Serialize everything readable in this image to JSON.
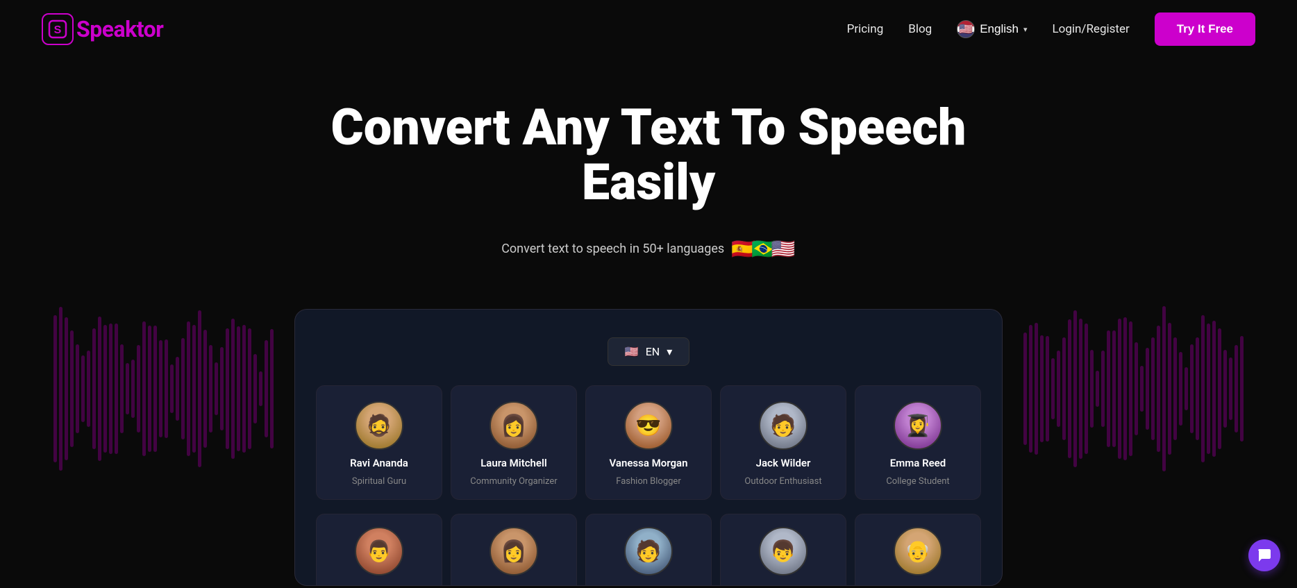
{
  "logo": {
    "icon_letter": "S",
    "text_before": "",
    "text_brand": "Speaktor"
  },
  "nav": {
    "pricing_label": "Pricing",
    "blog_label": "Blog",
    "language_label": "English",
    "login_label": "Login/Register",
    "cta_label": "Try It Free"
  },
  "hero": {
    "headline": "Convert Any Text To Speech Easily",
    "subtext": "Convert text to speech in 50+ languages",
    "flags": [
      "🇪🇸",
      "🇧🇷",
      "🇺🇸"
    ]
  },
  "demo": {
    "lang_selector": {
      "flag": "🇺🇸",
      "code": "EN",
      "chevron": "▾"
    },
    "voice_cards": [
      {
        "id": "ravi",
        "name": "Ravi Ananda",
        "role": "Spiritual Guru",
        "avatar_class": "av-ravi",
        "emoji": "🧔"
      },
      {
        "id": "laura",
        "name": "Laura Mitchell",
        "role": "Community Organizer",
        "avatar_class": "av-laura",
        "emoji": "👩"
      },
      {
        "id": "vanessa",
        "name": "Vanessa Morgan",
        "role": "Fashion Blogger",
        "avatar_class": "av-vanessa",
        "emoji": "😎"
      },
      {
        "id": "jack",
        "name": "Jack Wilder",
        "role": "Outdoor Enthusiast",
        "avatar_class": "av-jack",
        "emoji": "🧑"
      },
      {
        "id": "emma",
        "name": "Emma Reed",
        "role": "College Student",
        "avatar_class": "av-emma",
        "emoji": "👩‍🎓"
      }
    ],
    "voice_cards_bottom": [
      {
        "id": "b1",
        "avatar_class": "av-ravi",
        "emoji": "🧑"
      },
      {
        "id": "b2",
        "avatar_class": "av-person2",
        "emoji": "👩"
      },
      {
        "id": "b3",
        "avatar_class": "av-person3",
        "emoji": "👨"
      }
    ]
  }
}
